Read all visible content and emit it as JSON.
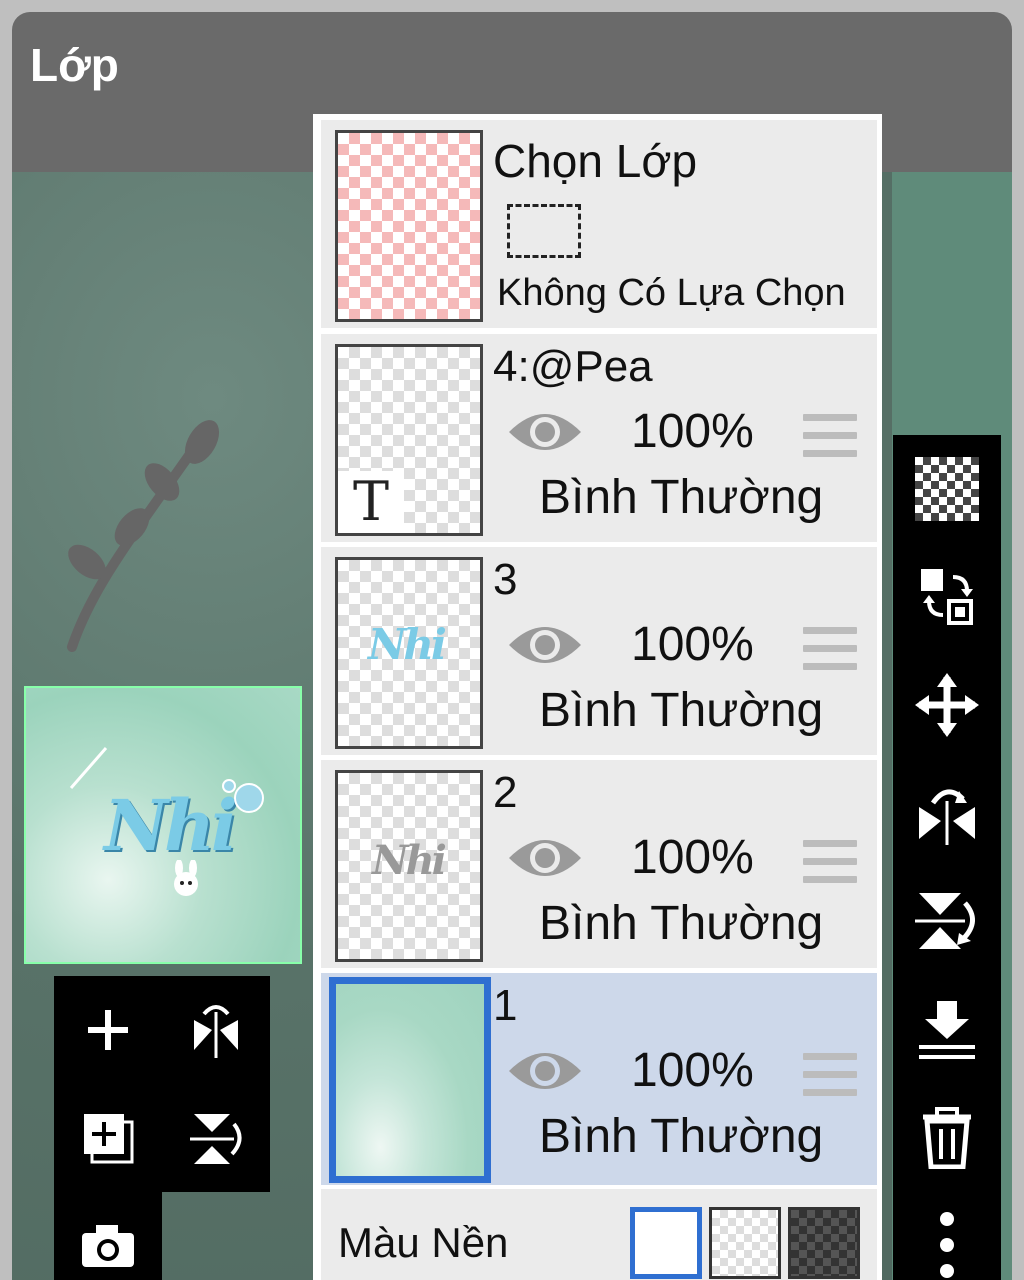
{
  "header": {
    "title": "Lớp"
  },
  "selection_layer": {
    "title": "Chọn Lớp",
    "status": "Không Có Lựa Chọn"
  },
  "layers": [
    {
      "name": "4:@Pea",
      "opacity": "100%",
      "blend": "Bình Thường",
      "type_badge": "T"
    },
    {
      "name": "3",
      "opacity": "100%",
      "blend": "Bình Thường"
    },
    {
      "name": "2",
      "opacity": "100%",
      "blend": "Bình Thường"
    },
    {
      "name": "1",
      "opacity": "100%",
      "blend": "Bình Thường",
      "selected": true
    }
  ],
  "background_color": {
    "label": "Màu Nền",
    "options": [
      "white",
      "transparent",
      "dark-checker"
    ],
    "selected": "white"
  },
  "thumbnail": {
    "text": "Nhi"
  },
  "left_toolbar": [
    "add-layer-icon",
    "flip-horizontal-icon",
    "add-layer-copy-icon",
    "flip-vertical-icon",
    "camera-icon"
  ],
  "right_toolbar": [
    "transparency-icon",
    "swap-layers-icon",
    "move-icon",
    "rotate-flip-icon",
    "flip-rotate-icon",
    "merge-down-icon",
    "trash-icon",
    "more-icon"
  ],
  "colors": {
    "accent": "#2f6fd1",
    "selected_row": "#cdd8ea",
    "row": "#ebebeb",
    "titlebar": "#6a6a6a"
  }
}
